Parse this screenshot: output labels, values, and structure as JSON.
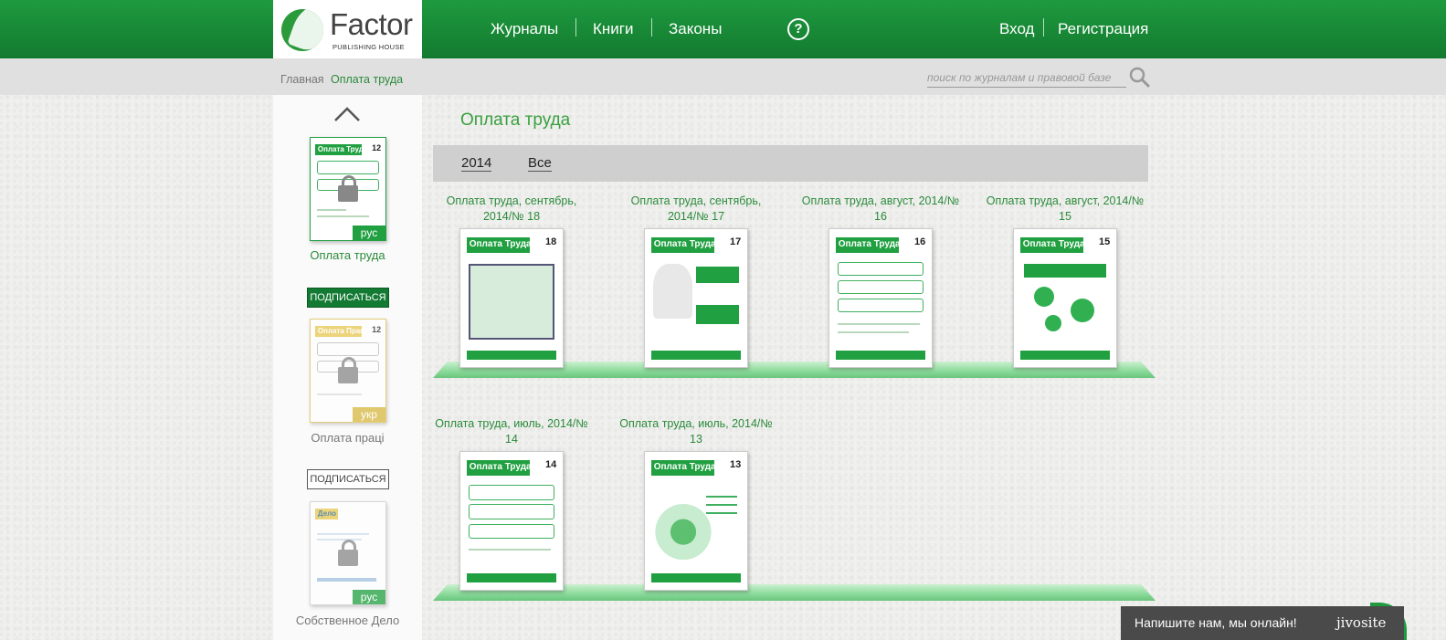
{
  "header": {
    "logo_name": "Factor",
    "logo_sub": "PUBLISHING HOUSE",
    "nav": [
      "Журналы",
      "Книги",
      "Законы"
    ],
    "help": "?",
    "login": "Вход",
    "register": "Регистрация"
  },
  "breadcrumb": {
    "home": "Главная",
    "current": "Оплата труда"
  },
  "search": {
    "placeholder": "поиск по журналам и правовой базе"
  },
  "sidebar": {
    "journals": [
      {
        "title": "Оплата труда",
        "cover_title": "Оплата Труда",
        "cover_number": "12",
        "lang": "рус",
        "color": "#20a040",
        "active": true
      },
      {
        "title": "Оплата праці",
        "cover_title": "Оплата Праці",
        "cover_number": "12",
        "lang": "укр",
        "color": "#e8c850",
        "active": false,
        "subscribe": "ПОДПИСАТЬСЯ"
      },
      {
        "title": "Собственное Дело",
        "cover_title": "Дело",
        "cover_number": "",
        "lang": "рус",
        "color": "#20a040",
        "active": false,
        "subscribe": "ПОДПИСАТЬСЯ"
      }
    ],
    "subscribe_active": "ПОДПИСАТЬСЯ"
  },
  "main": {
    "title": "Оплата труда",
    "filters": [
      "2014",
      "Все"
    ],
    "issues": [
      {
        "title": "Оплата труда, сентябрь, 2014/№ 18",
        "cover_title": "Оплата Труда",
        "number": "18"
      },
      {
        "title": "Оплата труда, сентябрь, 2014/№ 17",
        "cover_title": "Оплата Труда",
        "number": "17"
      },
      {
        "title": "Оплата труда, август, 2014/№ 16",
        "cover_title": "Оплата Труда",
        "number": "16"
      },
      {
        "title": "Оплата труда, август, 2014/№ 15",
        "cover_title": "Оплата Труда",
        "number": "15"
      },
      {
        "title": "Оплата труда, июль, 2014/№ 14",
        "cover_title": "Оплата Труда",
        "number": "14"
      },
      {
        "title": "Оплата труда, июль, 2014/№ 13",
        "cover_title": "Оплата Труда",
        "number": "13"
      }
    ]
  },
  "chat": {
    "text": "Напишите нам, мы онлайн!",
    "brand": "jivosite"
  },
  "colors": {
    "brand_green": "#1f9a3f",
    "accent_text": "#3aa040"
  }
}
